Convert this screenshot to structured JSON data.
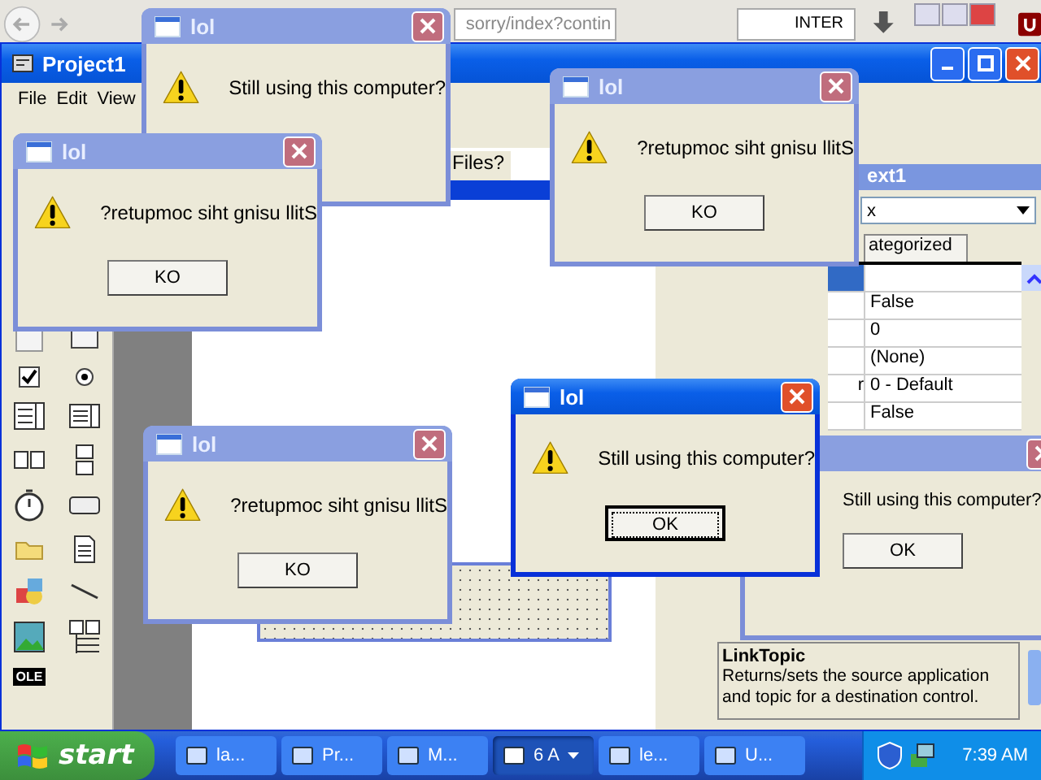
{
  "browser": {
    "address": "sorry/index?contin",
    "search": "INTER"
  },
  "ide": {
    "title": "Project1",
    "menu": [
      "File",
      "Edit",
      "View"
    ],
    "form_text": "Files?",
    "toolbox_ole": "OLE",
    "properties": {
      "title": "ext1",
      "object": "x",
      "tab": "ategorized",
      "rows": [
        {
          "value": "",
          "selected": true
        },
        {
          "value": "False",
          "selected": false
        },
        {
          "value": "0",
          "selected": false
        },
        {
          "value": "(None)",
          "selected": false
        },
        {
          "name": "r",
          "value": "0 - Default",
          "selected": false
        },
        {
          "value": "False",
          "selected": false
        }
      ]
    },
    "description": {
      "title": "LinkTopic",
      "text": "Returns/sets the source application and topic for a destination control."
    }
  },
  "dialogs": [
    {
      "title": "lol",
      "message": "Still using this computer?",
      "active": false
    },
    {
      "title": "lol",
      "message": "?retupmoc siht gnisu llitS",
      "button": "KO",
      "active": false,
      "focused": false
    },
    {
      "title": "lol",
      "message": "?retupmoc siht gnisu llitS",
      "button": "KO",
      "active": false,
      "focused": false
    },
    {
      "title": "lol",
      "message": "?retupmoc siht gnisu llitS",
      "button": "KO",
      "active": false,
      "focused": false
    },
    {
      "message": "Still using this computer?",
      "button": "OK",
      "active": false,
      "focused": false
    },
    {
      "title": "lol",
      "message": "Still using this computer?",
      "button": "OK",
      "active": true,
      "focused": true
    }
  ],
  "taskbar": {
    "start": "start",
    "items": [
      {
        "label": "la...",
        "selected": false
      },
      {
        "label": "Pr...",
        "selected": false
      },
      {
        "label": "M...",
        "selected": false
      },
      {
        "label": "6 A",
        "selected": true,
        "group": true
      },
      {
        "label": "le...",
        "selected": false
      },
      {
        "label": "U...",
        "selected": false
      }
    ],
    "clock": "7:39 AM"
  }
}
